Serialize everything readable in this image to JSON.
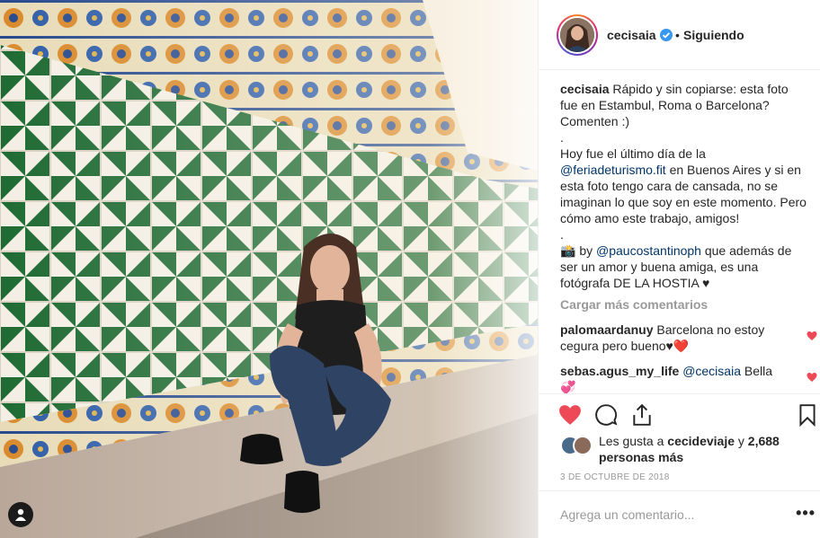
{
  "post": {
    "username": "cecisaia",
    "dot": "•",
    "follow_status": "Siguiendo",
    "caption_lines": [
      "Rápido y sin copiarse: esta foto fue en Estambul, Roma o Barcelona? Comenten :)",
      ".",
      "Hoy fue el último día de la",
      ".",
      "📸 by"
    ],
    "caption": {
      "part1": "Rápido y sin copiarse: esta foto fue en Estambul, Roma o Barcelona? Comenten :)",
      "dot1": ".",
      "part2a": "Hoy fue el último día de la ",
      "mention1": "@feriadeturismo.fit",
      "part2b": " en Buenos Aires y si en esta foto tengo cara de cansada, no se imaginan lo que soy en este momento. Pero cómo amo este trabajo, amigos!",
      "dot2": ".",
      "part3a": "📸 by ",
      "mention2": "@paucostantinoph",
      "part3b": " que además de ser un amor y buena amiga, es una fotógrafa DE LA HOSTIA ♥"
    },
    "load_more": "Cargar más comentarios",
    "comments": [
      {
        "user": "palomaardanuy",
        "text": " Barcelona no estoy cegura pero bueno♥❤️"
      },
      {
        "user": "sebas.agus_my_life",
        "mention": "@cecisaia",
        "text": " Bella 💞"
      }
    ],
    "likes": {
      "prefix": "Les gusta a ",
      "user": "cecideviaje",
      "middle": " y ",
      "count": "2,688 personas más"
    },
    "date": "3 DE OCTUBRE DE 2018",
    "add_comment_placeholder": "Agrega un comentario...",
    "more_options": "•••"
  },
  "icons": {
    "verified": "verified-badge-icon",
    "like": "heart-filled-icon",
    "comment": "comment-bubble-icon",
    "share": "share-upload-icon",
    "save": "bookmark-icon",
    "tag": "user-tag-icon"
  },
  "colors": {
    "like_red": "#ed4956",
    "link_blue": "#003569",
    "verified_blue": "#3897f0",
    "muted": "#999999"
  }
}
